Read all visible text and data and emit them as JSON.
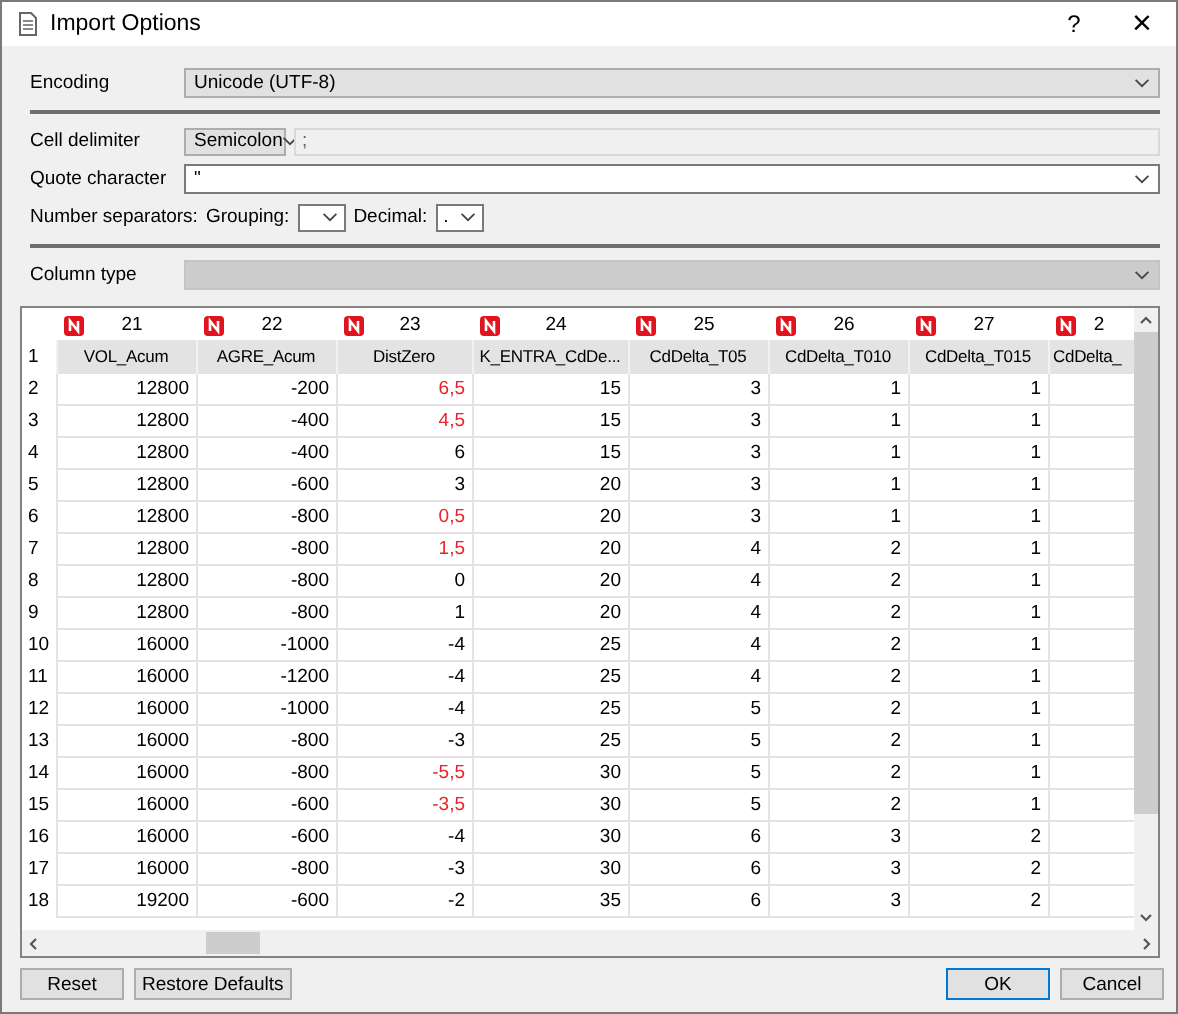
{
  "window": {
    "title": "Import Options",
    "help": "?",
    "close": "×"
  },
  "form": {
    "encoding": {
      "label": "Encoding",
      "value": "Unicode (UTF-8)"
    },
    "cell_delimiter": {
      "label": "Cell delimiter",
      "value": "Semicolon",
      "custom": ";"
    },
    "quote_character": {
      "label": "Quote character",
      "value": "\""
    },
    "number_separators": {
      "label": "Number separators:",
      "grouping_label": "Grouping:",
      "decimal_label": "Decimal:",
      "decimal": "."
    },
    "column_type": {
      "label": "Column type",
      "disabled": true
    }
  },
  "table": {
    "columns": [
      {
        "index": "21",
        "name": "VOL_Acum"
      },
      {
        "index": "22",
        "name": "AGRE_Acum"
      },
      {
        "index": "23",
        "name": "DistZero"
      },
      {
        "index": "24",
        "name": "K_ENTRA_CdDe..."
      },
      {
        "index": "25",
        "name": "CdDelta_T05"
      },
      {
        "index": "26",
        "name": "CdDelta_T010"
      },
      {
        "index": "27",
        "name": "CdDelta_T015"
      },
      {
        "index": "2",
        "name": "CdDelta_"
      }
    ],
    "header_row_number": "1",
    "rows": [
      {
        "number": "2",
        "cells": [
          "12800",
          "-200",
          "6,5",
          "15",
          "3",
          "1",
          "1"
        ],
        "warning": true
      },
      {
        "number": "3",
        "cells": [
          "12800",
          "-400",
          "4,5",
          "15",
          "3",
          "1",
          "1"
        ],
        "warning": true
      },
      {
        "number": "4",
        "cells": [
          "12800",
          "-400",
          "6",
          "15",
          "3",
          "1",
          "1"
        ],
        "warning": false
      },
      {
        "number": "5",
        "cells": [
          "12800",
          "-600",
          "3",
          "20",
          "3",
          "1",
          "1"
        ],
        "warning": false
      },
      {
        "number": "6",
        "cells": [
          "12800",
          "-800",
          "0,5",
          "20",
          "3",
          "1",
          "1"
        ],
        "warning": true
      },
      {
        "number": "7",
        "cells": [
          "12800",
          "-800",
          "1,5",
          "20",
          "4",
          "2",
          "1"
        ],
        "warning": true
      },
      {
        "number": "8",
        "cells": [
          "12800",
          "-800",
          "0",
          "20",
          "4",
          "2",
          "1"
        ],
        "warning": false
      },
      {
        "number": "9",
        "cells": [
          "12800",
          "-800",
          "1",
          "20",
          "4",
          "2",
          "1"
        ],
        "warning": false
      },
      {
        "number": "10",
        "cells": [
          "16000",
          "-1000",
          "-4",
          "25",
          "4",
          "2",
          "1"
        ],
        "warning": false
      },
      {
        "number": "11",
        "cells": [
          "16000",
          "-1200",
          "-4",
          "25",
          "4",
          "2",
          "1"
        ],
        "warning": false
      },
      {
        "number": "12",
        "cells": [
          "16000",
          "-1000",
          "-4",
          "25",
          "5",
          "2",
          "1"
        ],
        "warning": false
      },
      {
        "number": "13",
        "cells": [
          "16000",
          "-800",
          "-3",
          "25",
          "5",
          "2",
          "1"
        ],
        "warning": false
      },
      {
        "number": "14",
        "cells": [
          "16000",
          "-800",
          "-5,5",
          "30",
          "5",
          "2",
          "1"
        ],
        "warning": true
      },
      {
        "number": "15",
        "cells": [
          "16000",
          "-600",
          "-3,5",
          "30",
          "5",
          "2",
          "1"
        ],
        "warning": true
      },
      {
        "number": "16",
        "cells": [
          "16000",
          "-600",
          "-4",
          "30",
          "6",
          "3",
          "2"
        ],
        "warning": false
      },
      {
        "number": "17",
        "cells": [
          "16000",
          "-800",
          "-3",
          "30",
          "6",
          "3",
          "2"
        ],
        "warning": false
      },
      {
        "number": "18",
        "cells": [
          "19200",
          "-600",
          "-2",
          "35",
          "6",
          "3",
          "2"
        ],
        "warning": false
      }
    ]
  },
  "buttons": {
    "left": [
      "Reset",
      "Restore Defaults"
    ],
    "right": [
      {
        "label": "OK",
        "default": true
      },
      {
        "label": "Cancel",
        "default": false
      }
    ]
  }
}
